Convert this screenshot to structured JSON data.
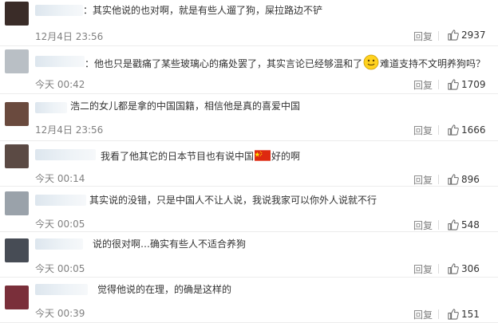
{
  "comments": [
    {
      "text": "：其实他说的也对啊，就是有些人遛了狗，屎拉路边不铲",
      "time": "12月4日 23:56",
      "reply": "回复",
      "likes": "2937",
      "avatar_color": "#3a2c28"
    },
    {
      "text_before": "：他也只是戳痛了某些玻璃心的痛处罢了，其实言论已经够温和了",
      "text_after": "难道支持不文明养狗吗？",
      "emoji_icon": "smiley-icon",
      "time": "今天 00:42",
      "reply": "回复",
      "likes": "1709",
      "avatar_color": "#b9bfc5"
    },
    {
      "text": "浩二的女儿都是拿的中国国籍，相信他是真的喜爱中国",
      "time": "12月4日 23:56",
      "reply": "回复",
      "likes": "1666",
      "avatar_color": "#6a4a3e"
    },
    {
      "text_before": "我看了他其它的日本节目也有说中国",
      "text_after": "好的啊",
      "flag_icon": "china-flag-icon",
      "time": "今天 00:14",
      "reply": "回复",
      "likes": "896",
      "avatar_color": "#5b4a44"
    },
    {
      "text": "其实说的没错，只是中国人不让人说，我说我家可以你外人说就不行",
      "time": "今天 00:05",
      "reply": "回复",
      "likes": "548",
      "avatar_color": "#9aa2aa"
    },
    {
      "text": "说的很对啊…确实有些人不适合养狗",
      "time": "今天 00:05",
      "reply": "回复",
      "likes": "306",
      "avatar_color": "#474c55"
    },
    {
      "text": "觉得他说的在理，的确是这样的",
      "time": "今天 00:39",
      "reply": "回复",
      "likes": "151",
      "avatar_color": "#7a2f3a"
    }
  ],
  "colors": {
    "time": "#808080",
    "text": "#333333",
    "like_icon": "#6b6b6b",
    "flag": "#de2910",
    "emoji": "#ffd21f"
  }
}
